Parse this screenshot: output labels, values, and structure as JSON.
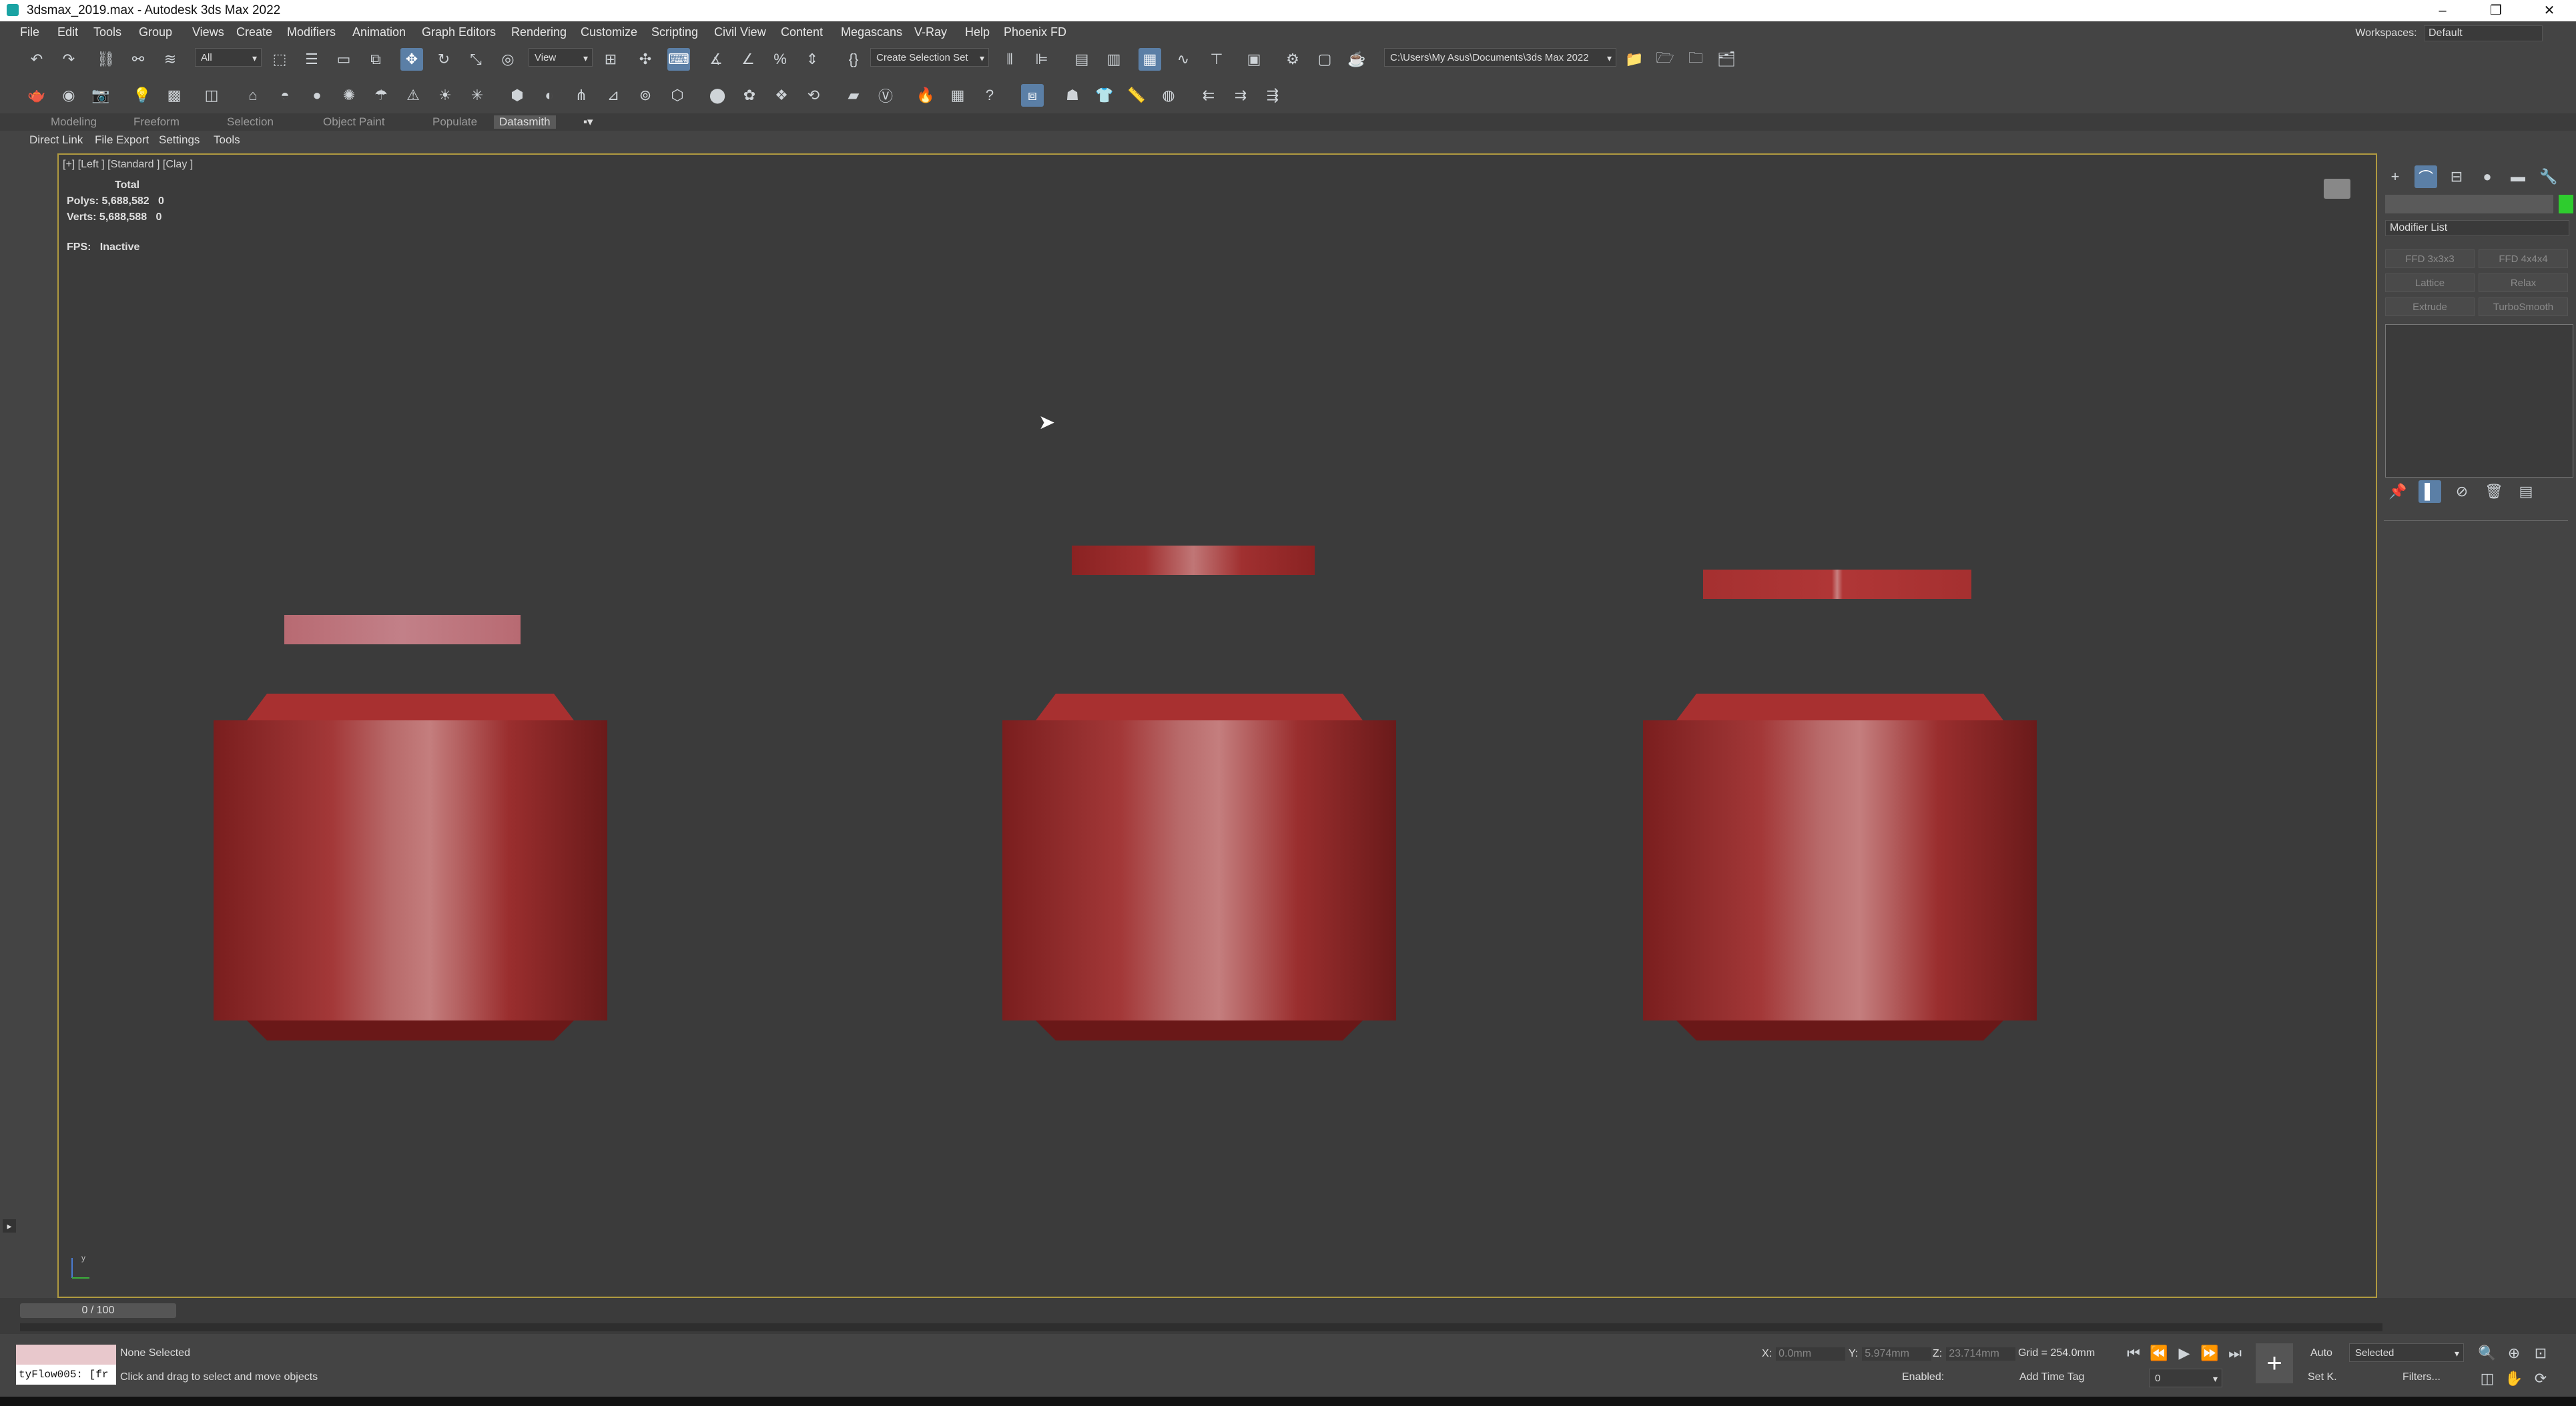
{
  "window": {
    "title": "3dsmax_2019.max - Autodesk 3ds Max 2022"
  },
  "menu": [
    "File",
    "Edit",
    "Tools",
    "Group",
    "Views",
    "Create",
    "Modifiers",
    "Animation",
    "Graph Editors",
    "Rendering",
    "Customize",
    "Scripting",
    "Civil View",
    "Content",
    "Megascans",
    "V-Ray",
    "Help",
    "Phoenix FD"
  ],
  "workspace": {
    "label": "Workspaces:",
    "value": "Default"
  },
  "toolbar": {
    "filter_value": "All",
    "view_value": "View",
    "selection_set": "Create Selection Set",
    "project_path": "C:\\Users\\My Asus\\Documents\\3ds Max 2022"
  },
  "ribbon": {
    "tabs": [
      "Modeling",
      "Freeform",
      "Selection",
      "Object Paint",
      "Populate",
      "Datasmith"
    ],
    "active": "Datasmith"
  },
  "substrip": [
    "Direct Link",
    "File Export",
    "Settings",
    "Tools"
  ],
  "viewport": {
    "label": "[+] [Left ] [Standard ] [Clay ]",
    "stats_total": "Total",
    "polys_label": "Polys:",
    "polys_value": "5,688,582",
    "polys_sel": "0",
    "verts_label": "Verts:",
    "verts_value": "5,688,588",
    "verts_sel": "0",
    "fps_label": "FPS:",
    "fps_value": "Inactive"
  },
  "command_panel": {
    "modifier_list": "Modifier List",
    "buttons": [
      "FFD 3x3x3",
      "FFD 4x4x4",
      "Lattice",
      "Relax",
      "Extrude",
      "TurboSmooth"
    ]
  },
  "timeline": {
    "frame": "0 / 100"
  },
  "status": {
    "selection": "None Selected",
    "prompt": "Click and drag to select and move objects",
    "maxscript": "tyFlow005: [fr",
    "x_label": "X:",
    "x_value": "0.0mm",
    "y_label": "Y:",
    "y_value": "5.974mm",
    "z_label": "Z:",
    "z_value": "23.714mm",
    "grid": "Grid = 254.0mm",
    "enabled": "Enabled:",
    "add_time_tag": "Add Time Tag",
    "auto": "Auto",
    "setk": "Set K.",
    "selected": "Selected",
    "filters": "Filters...",
    "frame_field": "0"
  },
  "colors": {
    "accent_blue": "#5b7fa6",
    "viewport_border": "#b09a40",
    "object_red": "#a03030"
  }
}
